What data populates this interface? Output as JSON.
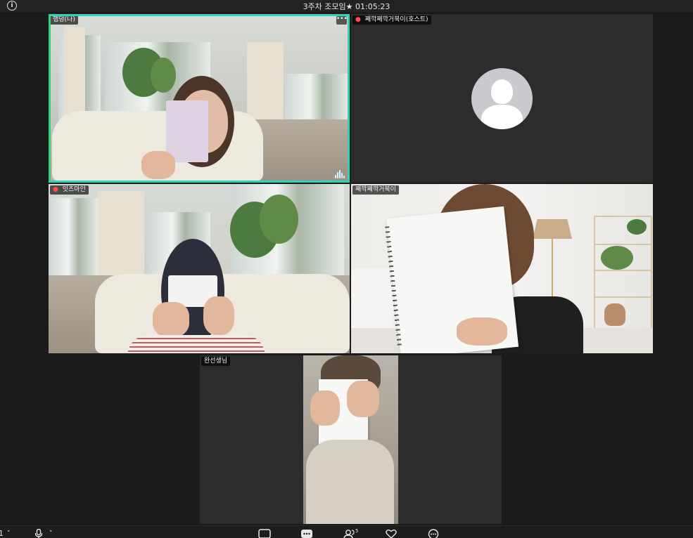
{
  "topbar": {
    "meeting_title": "3주차 조모임★ 01:05:23",
    "info_glyph": "i"
  },
  "participants": [
    {
      "name": "햄덩(나)",
      "muted": false,
      "active_speaker": true
    },
    {
      "name": "쪠깍쪠깍거북이(호스트)",
      "muted": true,
      "video": false
    },
    {
      "name": "잇츠마인",
      "muted": true
    },
    {
      "name": "쪠깍쪠깍거북이",
      "muted": false
    },
    {
      "name": "완선생님",
      "muted": false
    }
  ],
  "tile_controls": {
    "more_glyph": "•••"
  },
  "toolbar": {
    "camera_glyph": "1",
    "chevron_glyph": "˅",
    "participants_count": "5"
  },
  "colors": {
    "active_speaker_border": "#2ed47a",
    "mute_icon": "#ff4d4d",
    "background": "#1b1b1b"
  }
}
